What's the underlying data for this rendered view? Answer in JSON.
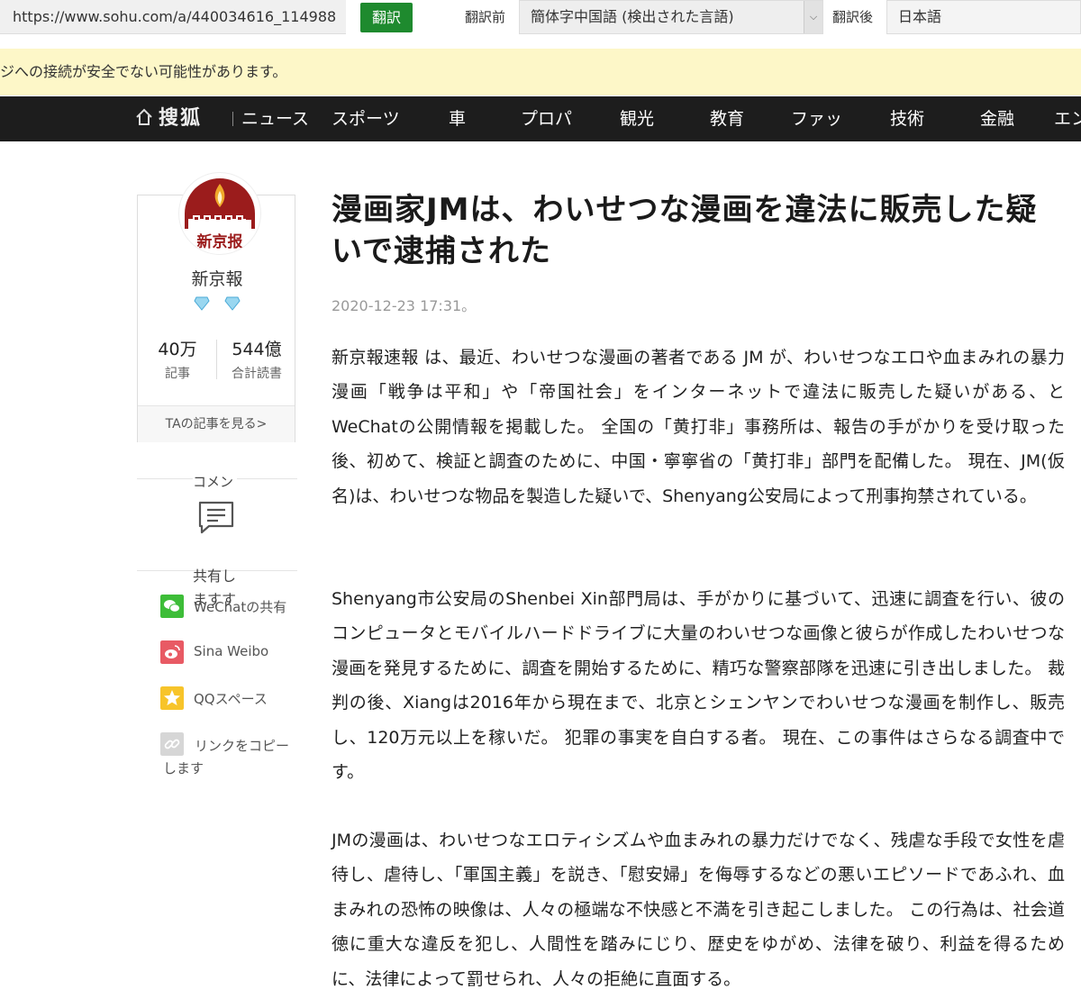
{
  "translate_bar": {
    "url": "https://www.sohu.com/a/440034616_114988",
    "translate_button": "翻訳",
    "source_label": "翻訳前",
    "source_language": "簡体字中国語 (検出された言語)",
    "target_label": "翻訳後",
    "target_language": "日本語"
  },
  "warning": "ジへの接続が安全でない可能性があります。",
  "nav": {
    "logo": "搜狐",
    "items": [
      "ニュース",
      "スポーツ",
      "車",
      "プロパ",
      "観光",
      "教育",
      "ファッ",
      "技術",
      "金融",
      "エン"
    ]
  },
  "source_card": {
    "name": "新京報",
    "avatar_text": "新京报",
    "stats": [
      {
        "value": "40万",
        "label": "記事"
      },
      {
        "value": "544億",
        "label": "合計読書"
      }
    ],
    "more_link": "TAの記事を見る>"
  },
  "comment_label": "コメン",
  "share": {
    "label": "共有しますす",
    "items": [
      {
        "icon": "wechat-icon",
        "label": "WeChatの共有",
        "color": "#3dbd38"
      },
      {
        "icon": "weibo-icon",
        "label": "Sina Weibo",
        "color": "#e85a64"
      },
      {
        "icon": "qzone-icon",
        "label": "QQスペース",
        "color": "#f7c42a"
      },
      {
        "icon": "link-icon",
        "label": "リンクをコピーします",
        "color": "#d6d6d6"
      }
    ]
  },
  "article": {
    "title": "漫画家JMは、わいせつな漫画を違法に販売した疑いで逮捕された",
    "date": "2020-12-23 17:31。",
    "paragraphs": [
      "新京報速報 は、最近、わいせつな漫画の著者である JM が、わいせつなエロや血まみれの暴力漫画「戦争は平和」や「帝国社会」をインターネットで違法に販売した疑いがある、とWeChatの公開情報を掲載した。 全国の「黄打非」事務所は、報告の手がかりを受け取った後、初めて、検証と調査のために、中国・寧寧省の「黄打非」部門を配備した。 現在、JM(仮名)は、わいせつな物品を製造した疑いで、Shenyang公安局によって刑事拘禁されている。",
      "Shenyang市公安局のShenbei Xin部門局は、手がかりに基づいて、迅速に調査を行い、彼のコンピュータとモバイルハードドライブに大量のわいせつな画像と彼らが作成したわいせつな漫画を発見するために、調査を開始するために、精巧な警察部隊を迅速に引き出しました。 裁判の後、Xiangは2016年から現在まで、北京とシェンヤンでわいせつな漫画を制作し、販売し、120万元以上を稼いだ。 犯罪の事実を自白する者。 現在、この事件はさらなる調査中です。",
      "JMの漫画は、わいせつなエロティシズムや血まみれの暴力だけでなく、残虐な手段で女性を虐待し、虐待し、「軍国主義」を説き、「慰安婦」を侮辱するなどの悪いエピソードであふれ、血まみれの恐怖の映像は、人々の極端な不快感と不満を引き起こしました。 この行為は、社会道徳に重大な違反を犯し、人間性を踏みにじり、歴史をゆがめ、法律を破り、利益を得るために、法律によって罰せられ、人々の拒絶に直面する。"
    ]
  }
}
